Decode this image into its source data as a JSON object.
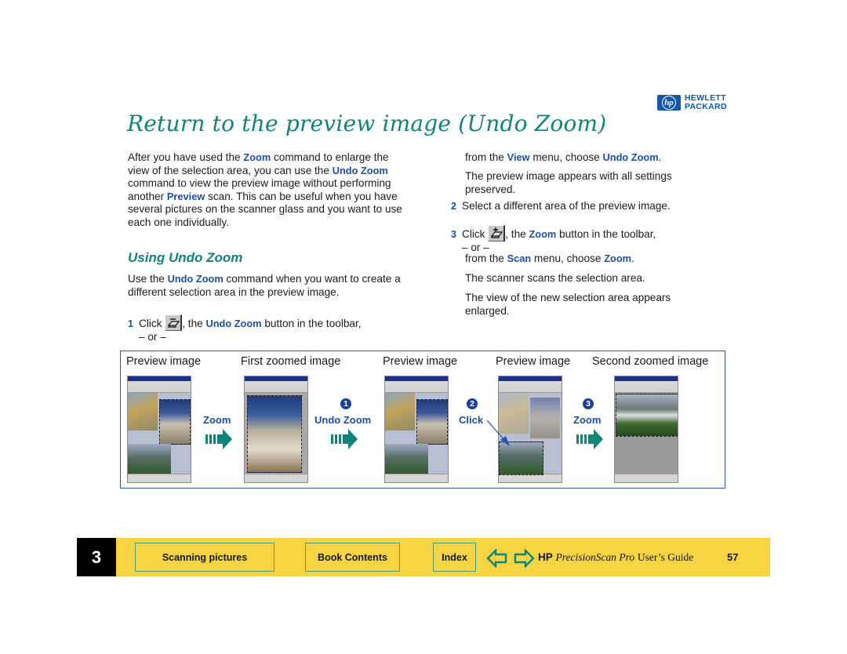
{
  "brand": {
    "logo_mark": "hp",
    "logo_line1": "HEWLETT",
    "logo_line2": "PACKARD",
    "color": "#1257a8"
  },
  "title": "Return to the preview image (Undo Zoom)",
  "colors": {
    "title": "#0f8579",
    "keyword": "#1d4fa5",
    "footer_bg": "#f6d443",
    "figure_border": "#2f55a8"
  },
  "left_column": {
    "intro": [
      {
        "t": "After you have used the "
      },
      {
        "k": "Zoom"
      },
      {
        "t": " command to enlarge the view of the selection area, you can use the "
      },
      {
        "k": "Undo Zoom"
      },
      {
        "t": " command to view the preview image without performing another "
      },
      {
        "k": "Preview"
      },
      {
        "t": " scan. This can be useful when you have several pictures on the scanner glass and you want to use each one individually."
      }
    ],
    "subheading": "Using Undo Zoom",
    "para2": [
      {
        "t": "Use the "
      },
      {
        "k": "Undo Zoom"
      },
      {
        "t": " command when you want to create a different selection area in the preview image."
      }
    ],
    "step1": {
      "num": "1",
      "pre": "Click ",
      "icon": "undo-zoom-toolbar-icon",
      "mid": ", the ",
      "kw": "Undo Zoom",
      "post": " button in the toolbar,",
      "or": "– or –"
    }
  },
  "right_column": {
    "step1_cont": [
      {
        "t": "from the "
      },
      {
        "k": "View"
      },
      {
        "t": " menu, choose "
      },
      {
        "k": "Undo Zoom"
      },
      {
        "t": "."
      }
    ],
    "result1": "The preview image appears with all settings preserved.",
    "step2": {
      "num": "2",
      "text": "Select a different area of the preview image."
    },
    "step3": {
      "num": "3",
      "pre": "Click ",
      "icon": "zoom-toolbar-icon",
      "mid": ", the ",
      "kw": "Zoom",
      "post": " button in the toolbar,",
      "or": "– or –"
    },
    "step3_cont": [
      {
        "t": "from the "
      },
      {
        "k": "Scan"
      },
      {
        "t": " menu, choose "
      },
      {
        "k": "Zoom"
      },
      {
        "t": "."
      }
    ],
    "result2": "The scanner scans the selection area.",
    "result3": "The view of the new selection area appears enlarged."
  },
  "figure": {
    "captions": [
      "Preview image",
      "First zoomed image",
      "Preview image",
      "Preview image",
      "Second zoomed image"
    ],
    "transitions": [
      {
        "step": "",
        "label": "Zoom",
        "icon": "arrow-right-icon"
      },
      {
        "step": "1",
        "label": "Undo Zoom",
        "icon": "arrow-right-icon"
      },
      {
        "step": "2",
        "label": "Click",
        "icon": "pointer-arrow-icon"
      },
      {
        "step": "3",
        "label": "Zoom",
        "icon": "arrow-right-icon"
      }
    ]
  },
  "footer": {
    "chapter": "3",
    "buttons": [
      "Scanning pictures",
      "Book Contents",
      "Index"
    ],
    "prev_icon": "back-arrow-icon",
    "next_icon": "forward-arrow-icon",
    "guide_hp": "HP",
    "guide_product": "PrecisionScan Pro",
    "guide_rest": "User’s Guide",
    "page": "57"
  }
}
